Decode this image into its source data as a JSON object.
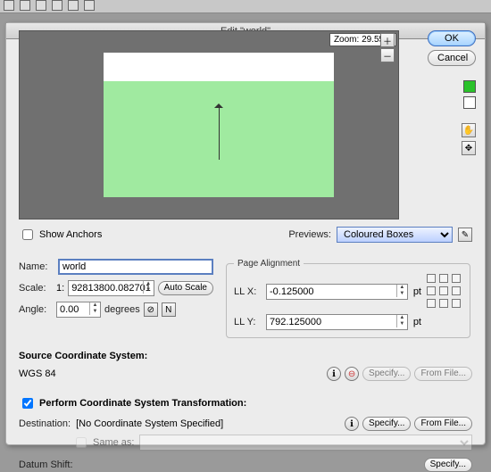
{
  "title": "Edit \"world\"",
  "zoom_label": "Zoom: 29.55%",
  "buttons": {
    "ok": "OK",
    "cancel": "Cancel",
    "auto_scale": "Auto Scale",
    "specify": "Specify...",
    "from_file": "From File..."
  },
  "show_anchors": {
    "label": "Show Anchors",
    "checked": false
  },
  "previews": {
    "label": "Previews:",
    "value": "Coloured Boxes"
  },
  "name": {
    "label": "Name:",
    "value": "world"
  },
  "scale": {
    "label": "Scale:",
    "prefix": "1:",
    "value": "92813800.082701"
  },
  "angle": {
    "label": "Angle:",
    "value": "0.00",
    "unit": "degrees"
  },
  "page_align": {
    "legend": "Page Alignment",
    "llx_label": "LL X:",
    "llx_value": "-0.125000",
    "lly_label": "LL Y:",
    "lly_value": "792.125000",
    "unit": "pt"
  },
  "scs": {
    "heading": "Source Coordinate System:",
    "value": "WGS 84"
  },
  "transform": {
    "checkbox_label": "Perform Coordinate System Transformation:",
    "checked": true,
    "dest_label": "Destination:",
    "dest_value": "[No Coordinate System Specified]",
    "same_as_label": "Same as:",
    "datum_label": "Datum Shift:"
  },
  "colors": {
    "swatch": "#2ac22a"
  }
}
